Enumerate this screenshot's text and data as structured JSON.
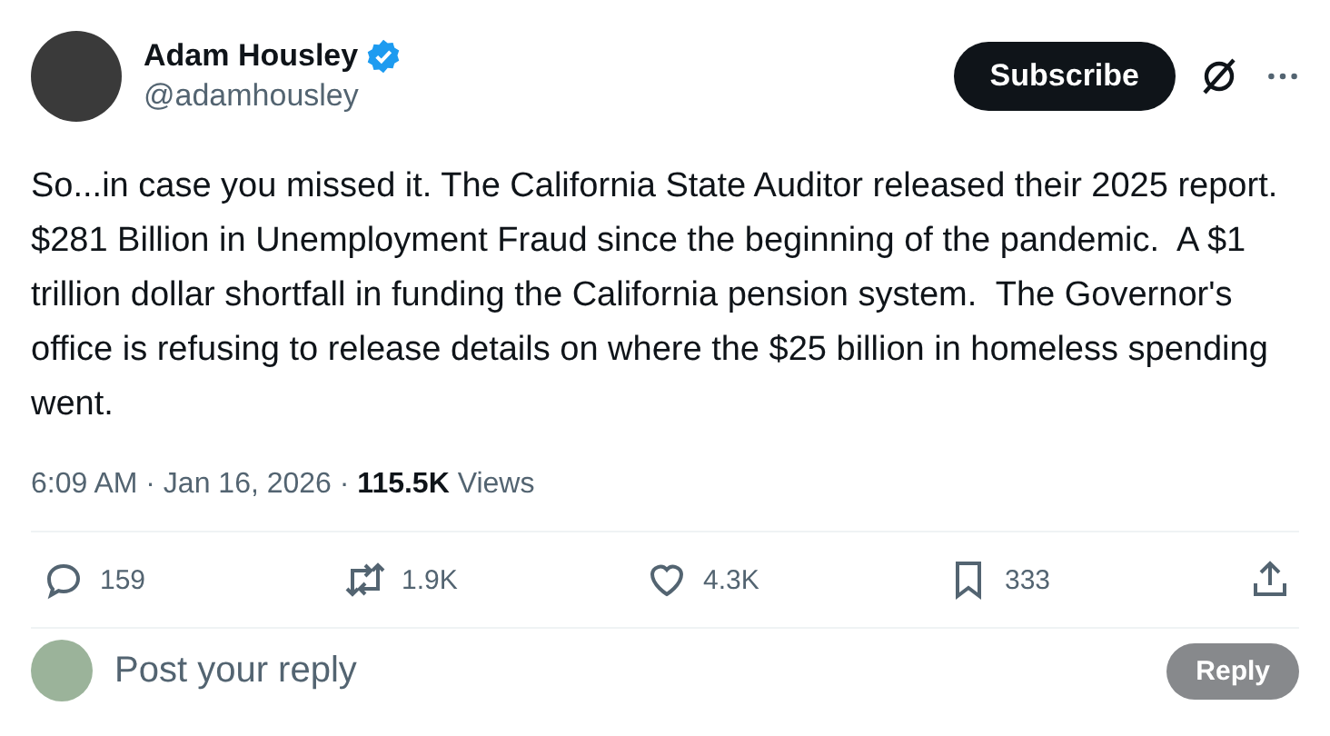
{
  "author": {
    "name": "Adam Housley",
    "verified": true,
    "handle": "@adamhousley"
  },
  "subscribe_button": "Subscribe",
  "body": "So...in case you missed it. The California State Auditor released their 2025 report.  $281 Billion in Unemployment Fraud since the beginning of the pandemic.  A $1 trillion dollar shortfall in funding the California pension system.  The Governor's office is refusing to release details on where the $25 billion in homeless spending went.",
  "meta": {
    "line": "6:09 AM · Jan 16, 2026 · **115.5K** Views"
  },
  "actions": [
    {
      "kind": "reply",
      "count": "159"
    },
    {
      "kind": "repost",
      "count": "1.9K"
    },
    {
      "kind": "like",
      "count": "4.3K"
    },
    {
      "kind": "bookmark",
      "count": "333"
    },
    {
      "kind": "share"
    }
  ],
  "composer": {
    "placeholder": "Post your reply",
    "button": "Reply"
  }
}
